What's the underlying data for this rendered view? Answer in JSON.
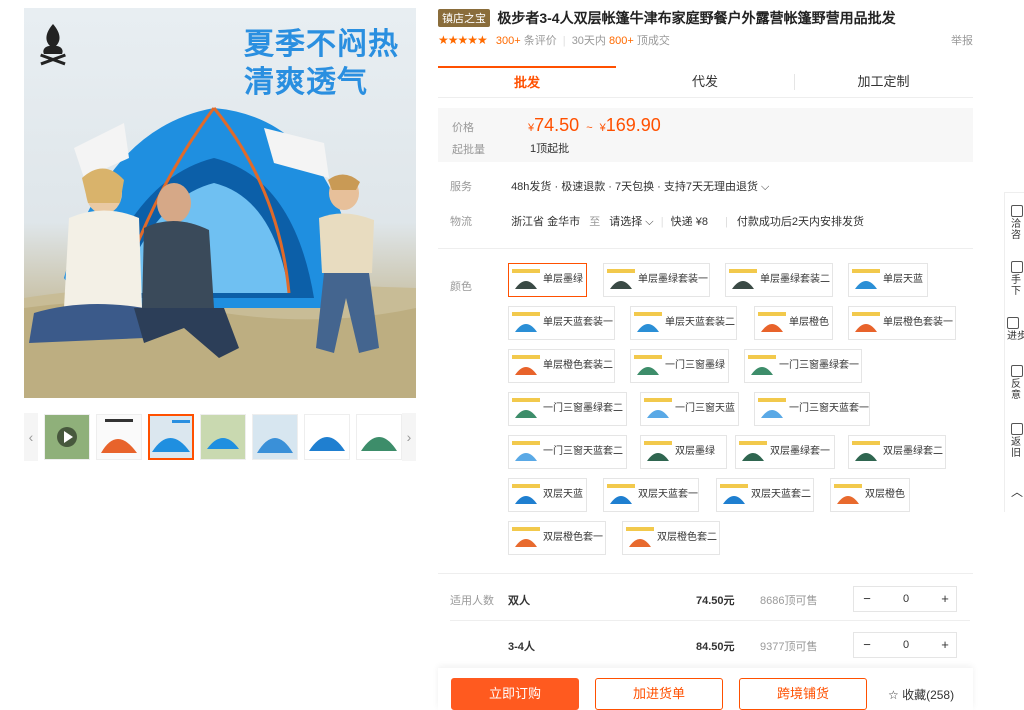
{
  "gallery": {
    "slogan_line1": "夏季不闷热",
    "slogan_line2": "清爽透气",
    "thumb_count": 7,
    "active_thumb": 2
  },
  "product": {
    "shop_badge": "镇店之宝",
    "title": "极步者3-4人双层帐篷牛津布家庭野餐户外露营帐篷野营用品批发",
    "stars": "★★★★★",
    "reviews_count": "300+",
    "reviews_label": "条评价",
    "sep": "|",
    "sold_prefix": "30天内",
    "sold_count": "800+",
    "sold_suffix": "顶成交",
    "report": "举报"
  },
  "tabs": [
    {
      "label": "批发"
    },
    {
      "label": "代发"
    },
    {
      "label": "加工定制"
    }
  ],
  "price": {
    "label": "价格",
    "currency": "¥",
    "min": "74.50",
    "range_sep": "~",
    "max": "169.90",
    "moq_label": "起批量",
    "moq_value": "1顶起批"
  },
  "service": {
    "label": "服务",
    "value": "48h发货 · 极速退款 · 7天包换 · 支持7天无理由退货 ⌵"
  },
  "logistics": {
    "label": "物流",
    "from": "浙江省 金华市",
    "to_label": "至",
    "to_value": "请选择 ⌵",
    "ship": "快递 ¥8",
    "note": "付款成功后2天内安排发货"
  },
  "colors": {
    "label": "颜色",
    "options": [
      {
        "name": "单层墨绿",
        "tone": "#3a4a45"
      },
      {
        "name": "单层墨绿套装一",
        "tone": "#3a4a45"
      },
      {
        "name": "单层墨绿套装二",
        "tone": "#3a4a45"
      },
      {
        "name": "单层天蓝",
        "tone": "#2b8fd6"
      },
      {
        "name": "单层天蓝套装一",
        "tone": "#2b8fd6"
      },
      {
        "name": "单层天蓝套装二",
        "tone": "#2b8fd6"
      },
      {
        "name": "单层橙色",
        "tone": "#e8632b"
      },
      {
        "name": "单层橙色套装一",
        "tone": "#e8632b"
      },
      {
        "name": "单层橙色套装二",
        "tone": "#e8632b"
      },
      {
        "name": "一门三窗墨绿",
        "tone": "#3d8d6a"
      },
      {
        "name": "一门三窗墨绿套一",
        "tone": "#3d8d6a"
      },
      {
        "name": "一门三窗墨绿套二",
        "tone": "#3d8d6a"
      },
      {
        "name": "一门三窗天蓝",
        "tone": "#5aa9e6"
      },
      {
        "name": "一门三窗天蓝套一",
        "tone": "#5aa9e6"
      },
      {
        "name": "一门三窗天蓝套二",
        "tone": "#5aa9e6"
      },
      {
        "name": "双层墨绿",
        "tone": "#2f6650"
      },
      {
        "name": "双层墨绿套一",
        "tone": "#2f6650"
      },
      {
        "name": "双层墨绿套二",
        "tone": "#2f6650"
      },
      {
        "name": "双层天蓝",
        "tone": "#1f7fd0"
      },
      {
        "name": "双层天蓝套一",
        "tone": "#1f7fd0"
      },
      {
        "name": "双层天蓝套二",
        "tone": "#1f7fd0"
      },
      {
        "name": "双层橙色",
        "tone": "#e86a2e"
      },
      {
        "name": "双层橙色套一",
        "tone": "#e86a2e"
      },
      {
        "name": "双层橙色套二",
        "tone": "#e86a2e"
      }
    ]
  },
  "quantity": {
    "label": "适用人数",
    "rows": [
      {
        "name": "双人",
        "price": "74.50元",
        "stock": "8686顶可售",
        "minus": "−",
        "qty": "0",
        "plus": "+"
      },
      {
        "name": "3-4人",
        "price": "84.50元",
        "stock": "9377顶可售",
        "minus": "−",
        "qty": "0",
        "plus": "+"
      }
    ]
  },
  "actions": {
    "order": "立即订购",
    "cart": "加进货单",
    "cross": "跨境铺货",
    "fav": "☆ 收藏(258)"
  },
  "sidebar": {
    "items": [
      {
        "label": "洽\n咨"
      },
      {
        "label": "手\n下"
      },
      {
        "label": "进步"
      },
      {
        "label": "反\n意"
      },
      {
        "label": "返\n旧"
      }
    ]
  },
  "colors_theme": {
    "accent": "#ff5000",
    "slogan": "#2a8fe0"
  }
}
